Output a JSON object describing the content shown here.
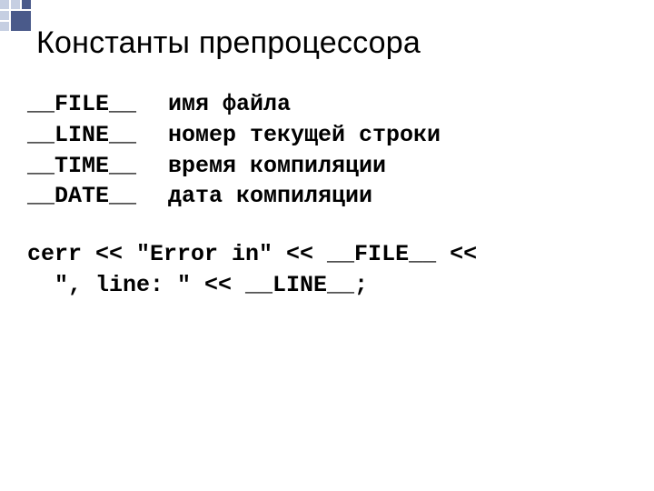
{
  "title": "Константы препроцессора",
  "rows": [
    {
      "macro": "__FILE__",
      "desc": "имя файла"
    },
    {
      "macro": "__LINE__",
      "desc": "номер текущей строки"
    },
    {
      "macro": "__TIME__",
      "desc": "время компиляции"
    },
    {
      "macro": "__DATE__",
      "desc": "дата компиляции"
    }
  ],
  "code": {
    "line1": "cerr << \"Error in\" << __FILE__ << ",
    "line2": "\", line: \" << __LINE__;"
  }
}
